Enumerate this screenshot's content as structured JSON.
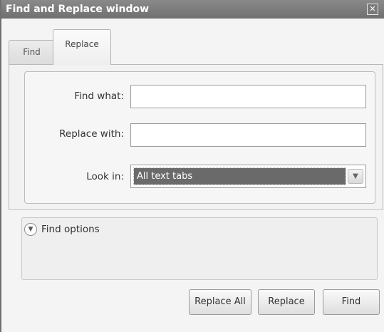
{
  "window": {
    "title": "Find and Replace window",
    "close_glyph": "✕"
  },
  "tabs": [
    {
      "label": "Find",
      "active": false
    },
    {
      "label": "Replace",
      "active": true
    }
  ],
  "form": {
    "find_label": "Find what:",
    "find_value": "",
    "replace_label": "Replace with:",
    "replace_value": "",
    "lookin_label": "Look in:",
    "lookin_value": "All text tabs"
  },
  "options": {
    "label": "Find options",
    "toggle_icon": "chevron-down-circle-icon"
  },
  "buttons": {
    "replace_all": "Replace All",
    "replace": "Replace",
    "find": "Find"
  },
  "colors": {
    "titlebar": "#7a7a7a",
    "selected_option_bg": "#6a6a6a"
  }
}
